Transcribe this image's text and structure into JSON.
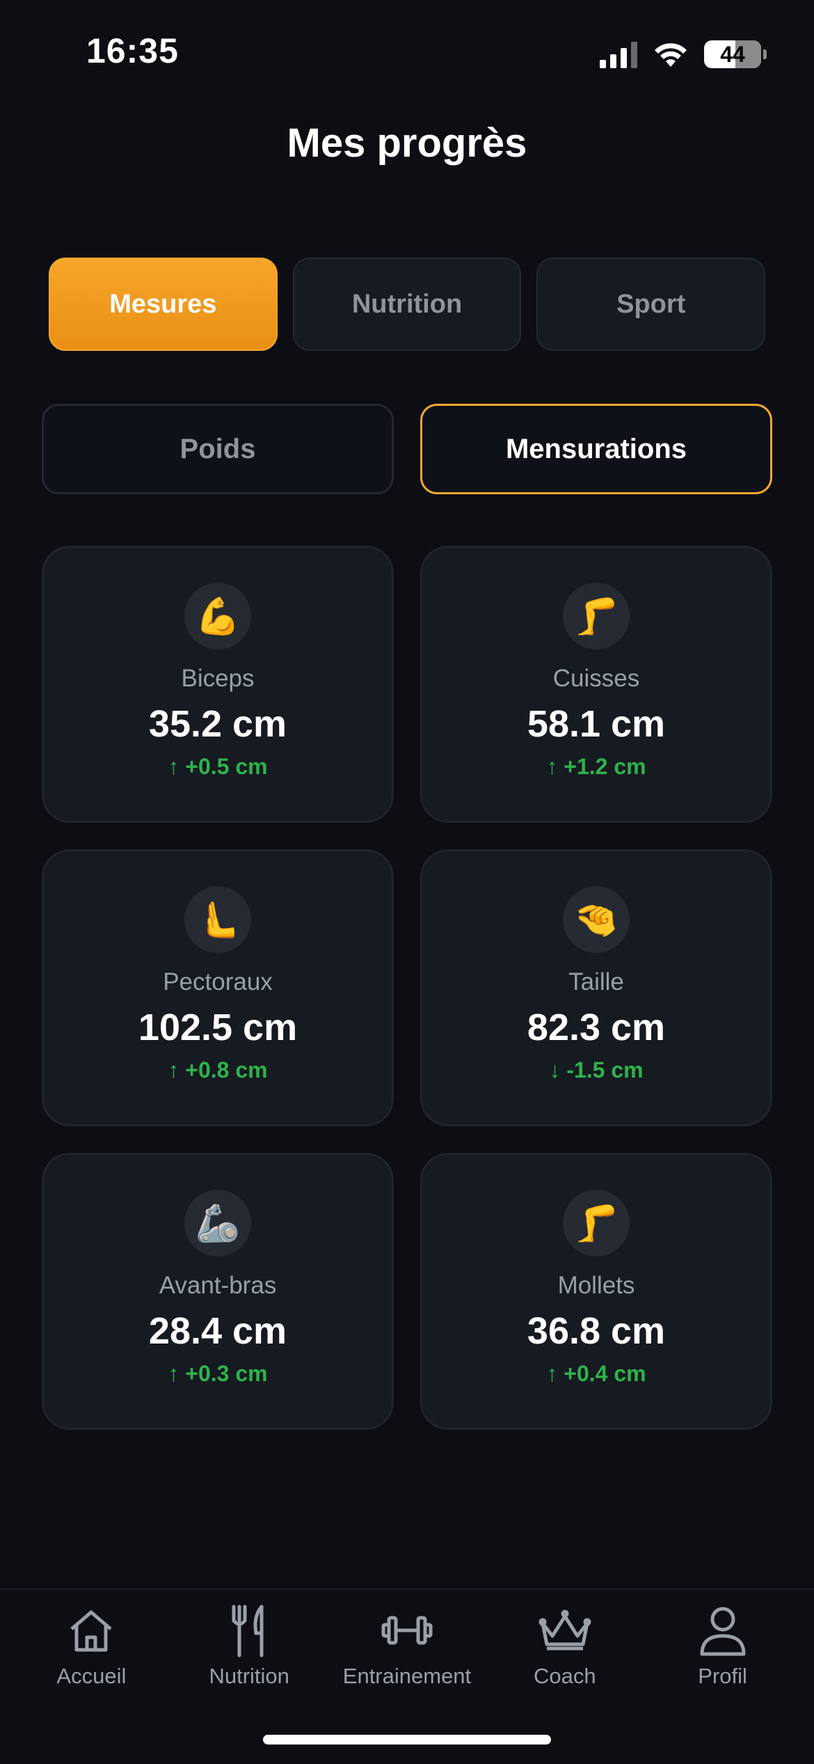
{
  "status_bar": {
    "time": "16:35",
    "battery": "44"
  },
  "page": {
    "title": "Mes progrès"
  },
  "category_tabs": [
    {
      "label": "Mesures",
      "active": true
    },
    {
      "label": "Nutrition",
      "active": false
    },
    {
      "label": "Sport",
      "active": false
    }
  ],
  "sub_tabs": [
    {
      "label": "Poids",
      "active": false
    },
    {
      "label": "Mensurations",
      "active": true
    }
  ],
  "measurements": [
    {
      "icon": "💪",
      "label": "Biceps",
      "value": "35.2 cm",
      "delta": "↑ +0.5 cm"
    },
    {
      "icon": "🦵",
      "label": "Cuisses",
      "value": "58.1 cm",
      "delta": "↑ +1.2 cm"
    },
    {
      "icon": "🫷",
      "label": "Pectoraux",
      "value": "102.5 cm",
      "delta": "↑ +0.8 cm"
    },
    {
      "icon": "🤏",
      "label": "Taille",
      "value": "82.3 cm",
      "delta": "↓ -1.5 cm"
    },
    {
      "icon": "🦾",
      "label": "Avant-bras",
      "value": "28.4 cm",
      "delta": "↑ +0.3 cm"
    },
    {
      "icon": "🦵",
      "label": "Mollets",
      "value": "36.8 cm",
      "delta": "↑ +0.4 cm"
    }
  ],
  "bottom_nav": [
    {
      "icon": "home-icon",
      "label": "Accueil"
    },
    {
      "icon": "fork-knife-icon",
      "label": "Nutrition"
    },
    {
      "icon": "dumbbell-icon",
      "label": "Entrainement"
    },
    {
      "icon": "crown-icon",
      "label": "Coach"
    },
    {
      "icon": "person-icon",
      "label": "Profil"
    }
  ],
  "colors": {
    "accent": "#F6A62A",
    "positive": "#2FB24C",
    "background": "#0C0E14",
    "card": "#161A21"
  }
}
